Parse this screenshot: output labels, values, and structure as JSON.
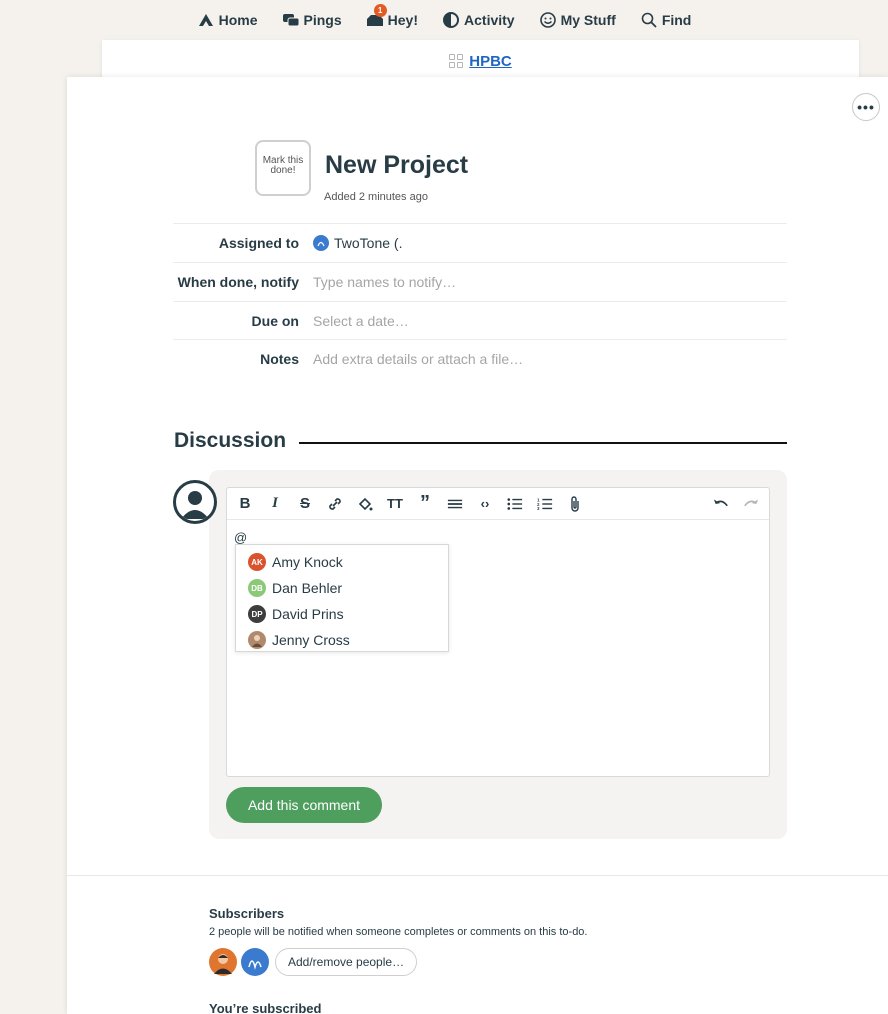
{
  "nav": {
    "items": [
      {
        "label": "Home",
        "icon": "home-icon"
      },
      {
        "label": "Pings",
        "icon": "chat-icon"
      },
      {
        "label": "Hey!",
        "icon": "hey-icon",
        "badge": "1"
      },
      {
        "label": "Activity",
        "icon": "activity-icon"
      },
      {
        "label": "My Stuff",
        "icon": "smiley-icon"
      },
      {
        "label": "Find",
        "icon": "search-icon"
      }
    ]
  },
  "breadcrumb": {
    "project": "HPBC"
  },
  "todo": {
    "checkbox_label": "Mark this done!",
    "title": "New Project",
    "added": "Added 2 minutes ago",
    "fields": [
      {
        "label": "Assigned to",
        "value": "TwoTone (."
      },
      {
        "label": "When done, notify",
        "placeholder": "Type names to notify…"
      },
      {
        "label": "Due on",
        "placeholder": "Select a date…"
      },
      {
        "label": "Notes",
        "placeholder": "Add extra details or attach a file…"
      }
    ]
  },
  "discussion": {
    "title": "Discussion",
    "editor_text": "@",
    "mentions": [
      {
        "initials": "AK",
        "name": "Amy Knock",
        "color": "#d9532f"
      },
      {
        "initials": "DB",
        "name": "Dan Behler",
        "color": "#8bc878"
      },
      {
        "initials": "DP",
        "name": "David Prins",
        "color": "#3d3d3d"
      },
      {
        "initials": "",
        "name": "Jenny Cross",
        "color": "#b08a6e"
      }
    ],
    "submit_label": "Add this comment"
  },
  "subscribers": {
    "title": "Subscribers",
    "text": "2 people will be notified when someone completes or comments on this to-do.",
    "button": "Add/remove people…",
    "status": "You’re subscribed"
  },
  "colors": {
    "accent": "#4e9e5e",
    "link": "#1f66c3",
    "badge": "#e25b24"
  }
}
